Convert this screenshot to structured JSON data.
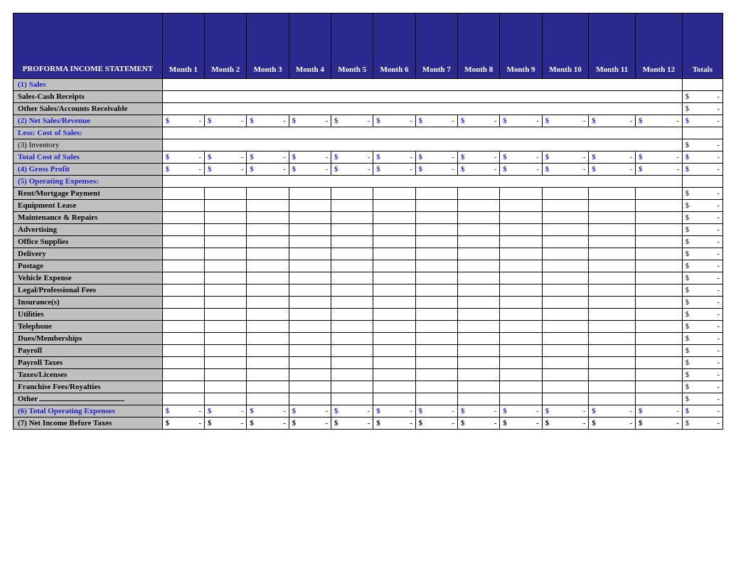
{
  "header": {
    "title": "PROFORMA INCOME STATEMENT",
    "months": [
      "Month 1",
      "Month 2",
      "Month 3",
      "Month 4",
      "Month 5",
      "Month 6",
      "Month 7",
      "Month 8",
      "Month 9",
      "Month 10",
      "Month 11",
      "Month 12"
    ],
    "totals": "Totals"
  },
  "rows": {
    "sales": "(1) Sales",
    "sales_cash": "Sales-Cash Receipts",
    "sales_ar": "Other Sales/Accounts Receivable",
    "net_sales": "(2) Net Sales/Revenue",
    "less_cost": "Less: Cost of Sales:",
    "inventory": "(3) Inventory",
    "total_cost": "Total Cost of Sales",
    "gross_profit": "(4) Gross Profit",
    "op_exp_head": "(5) Operating Expenses:",
    "rent": "Rent/Mortgage Payment",
    "equip_lease": "Equipment Lease",
    "maint": "Maintenance & Repairs",
    "adv": "Advertising",
    "office": "Office Supplies",
    "delivery": "Delivery",
    "postage": "Postage",
    "vehicle": "Vehicle Expense",
    "legal": "Legal/Professional Fees",
    "insurance": "Insurance(s)",
    "utilities": "Utilities",
    "telephone": "Telephone",
    "dues": "Dues/Memberships",
    "payroll": "Payroll",
    "payroll_tax": "Payroll Taxes",
    "taxes_lic": "Taxes/Licenses",
    "franchise": "Franchise Fees/Royalties",
    "other": "Other",
    "total_op": "(6) Total Operating Expenses",
    "net_income": "(7) Net Income Before Taxes"
  },
  "currency": {
    "symbol": "$",
    "dash": "-"
  }
}
